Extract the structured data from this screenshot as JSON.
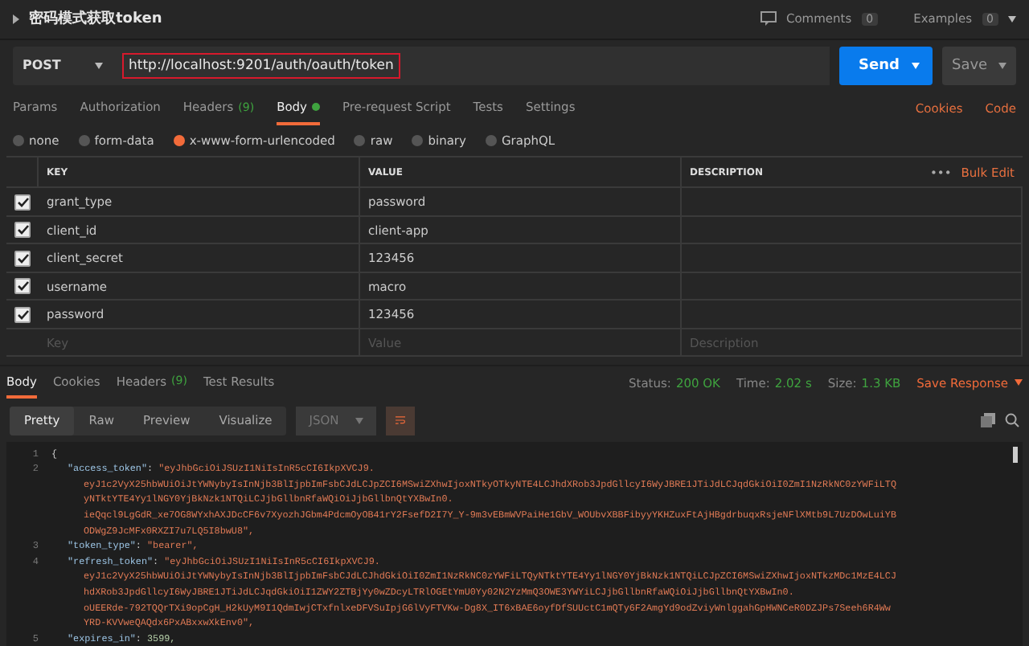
{
  "request": {
    "title": "密码模式获取token",
    "comments": {
      "label": "Comments",
      "count": "0"
    },
    "examples": {
      "label": "Examples",
      "count": "0"
    },
    "method": "POST",
    "url": "http://localhost:9201/auth/oauth/token",
    "send": "Send",
    "save": "Save"
  },
  "tabs": [
    {
      "label": "Params",
      "selected": false
    },
    {
      "label": "Authorization",
      "selected": false
    },
    {
      "label": "Headers",
      "count": "(9)",
      "selected": false
    },
    {
      "label": "Body",
      "dot": true,
      "selected": true
    },
    {
      "label": "Pre-request Script",
      "selected": false
    },
    {
      "label": "Tests",
      "selected": false
    },
    {
      "label": "Settings",
      "selected": false
    }
  ],
  "links": [
    "Cookies",
    "Code"
  ],
  "body_types": [
    {
      "label": "none",
      "selected": false
    },
    {
      "label": "form-data",
      "selected": false
    },
    {
      "label": "x-www-form-urlencoded",
      "selected": true
    },
    {
      "label": "raw",
      "selected": false
    },
    {
      "label": "binary",
      "selected": false
    },
    {
      "label": "GraphQL",
      "selected": false
    }
  ],
  "table": {
    "columns": [
      "KEY",
      "VALUE",
      "DESCRIPTION"
    ],
    "more": "•••",
    "bulk_edit": "Bulk Edit",
    "rows": [
      {
        "key": "grant_type",
        "value": "password",
        "checked": true
      },
      {
        "key": "client_id",
        "value": "client-app",
        "checked": true
      },
      {
        "key": "client_secret",
        "value": "123456",
        "checked": true
      },
      {
        "key": "username",
        "value": "macro",
        "checked": true
      },
      {
        "key": "password",
        "value": "123456",
        "checked": true
      }
    ],
    "new_row": {
      "key": {
        "placeholder": "Key"
      },
      "value": {
        "placeholder": "Value"
      },
      "description": {
        "placeholder": "Description"
      }
    }
  },
  "response": {
    "tabs": [
      {
        "label": "Body",
        "selected": true
      },
      {
        "label": "Cookies",
        "selected": false
      },
      {
        "label": "Headers",
        "count": "(9)",
        "selected": false
      },
      {
        "label": "Test Results",
        "selected": false
      }
    ],
    "status": [
      {
        "label": "Status:",
        "value": "200 OK"
      },
      {
        "label": "Time:",
        "value": "2.02 s"
      },
      {
        "label": "Size:",
        "value": "1.3 KB"
      }
    ],
    "save_response": "Save Response",
    "views": [
      {
        "label": "Pretty",
        "selected": true
      },
      {
        "label": "Raw",
        "selected": false
      },
      {
        "label": "Preview",
        "selected": false
      },
      {
        "label": "Visualize",
        "selected": false
      }
    ],
    "format": "JSON",
    "lines": [
      {
        "kind": "brace",
        "number": "1",
        "text": "{"
      },
      {
        "kind": "pair",
        "number": "2",
        "key": "\"access_token\"",
        "sep": ": ",
        "value": "\"eyJhbGciOiJSUzI1NiIsInR5cCI6IkpXVCJ9."
      },
      {
        "kind": "wrap",
        "value": "eyJ1c2VyX25hbWUiOiJtYWNybyIsInNjb3BlIjpbImFsbCJdLCJpZCI6MSwiZXhwIjoxNTkyOTkyNTE4LCJhdXRob3JpdGllcyI6WyJBRE1JTiJdLCJqdGkiOiI0ZmI1NzRkNC0zYWFiLTQ"
      },
      {
        "kind": "wrap",
        "value": "yNTktYTE4Yy1lNGY0YjBkNzk1NTQiLCJjbGllbnRfaWQiOiJjbGllbnQtYXBwIn0."
      },
      {
        "kind": "wrap",
        "value": "ieQqcl9LgGdR_xe7OG8WYxhAXJDcCF6v7XyozhJGbm4PdcmOyOB41rY2FsefD2I7Y_Y-9m3vEBmWVPaiHe1GbV_WOUbvXBBFibyyYKHZuxFtAjHBgdrbuqxRsjeNFlXMtb9L7UzDOwLuiYB"
      },
      {
        "kind": "wrap",
        "value": "ODWgZ9JcMFx0RXZI7u7LQ5I8bwU8\","
      },
      {
        "kind": "pair",
        "number": "3",
        "key": "\"token_type\"",
        "sep": ": ",
        "value": "\"bearer\","
      },
      {
        "kind": "pair",
        "number": "4",
        "key": "\"refresh_token\"",
        "sep": ": ",
        "value": "\"eyJhbGciOiJSUzI1NiIsInR5cCI6IkpXVCJ9."
      },
      {
        "kind": "wrap",
        "value": "eyJ1c2VyX25hbWUiOiJtYWNybyIsInNjb3BlIjpbImFsbCJdLCJhdGkiOiI0ZmI1NzRkNC0zYWFiLTQyNTktYTE4Yy1lNGY0YjBkNzk1NTQiLCJpZCI6MSwiZXhwIjoxNTkzMDc1MzE4LCJ"
      },
      {
        "kind": "wrap",
        "value": "hdXRob3JpdGllcyI6WyJBRE1JTiJdLCJqdGkiOiI1ZWY2ZTBjYy0wZDcyLTRlOGEtYmU0Yy02N2YzMmQ3OWE3YWYiLCJjbGllbnRfaWQiOiJjbGllbnQtYXBwIn0."
      },
      {
        "kind": "wrap",
        "value": "oUEERde-792TQQrTXi9opCgH_H2kUyM9I1QdmIwjCTxfnlxeDFVSuIpjG6lVyFTVKw-Dg8X_IT6xBAE6oyfDfSUUctC1mQTy6F2AmgYd9odZviyWnlggahGpHWNCeR0DZJPs7Seeh6R4Ww"
      },
      {
        "kind": "wrap",
        "value": "YRD-KVVweQAQdx6PxABxxwXkEnv0\","
      },
      {
        "kind": "number_pair",
        "number": "5",
        "key": "\"expires_in\"",
        "sep": ": ",
        "value": "3599,"
      }
    ]
  }
}
